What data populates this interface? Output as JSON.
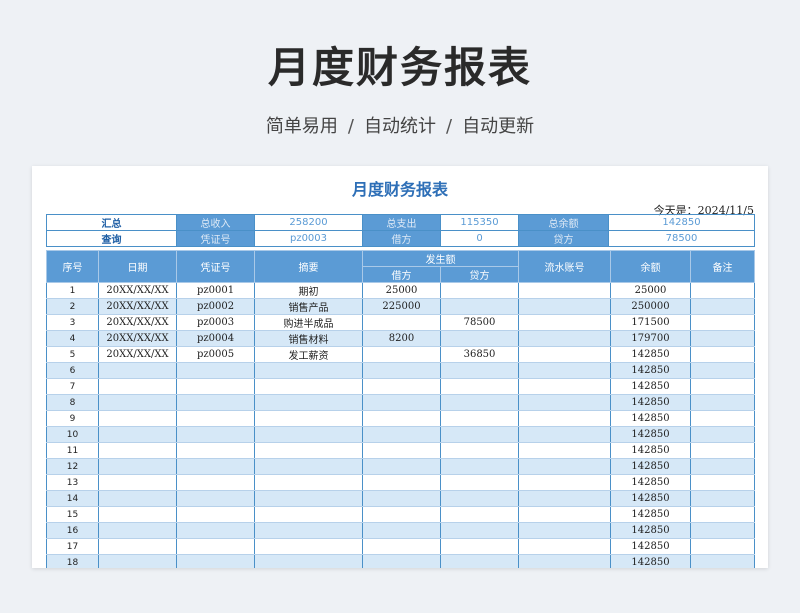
{
  "hero": {
    "title": "月度财务报表",
    "features": [
      "简单易用",
      "自动统计",
      "自动更新"
    ],
    "separator": "/"
  },
  "sheet": {
    "title": "月度财务报表",
    "today": "今天是：2024/11/5",
    "summary": {
      "row1": {
        "label": "汇总",
        "income_label": "总收入",
        "income": "258200",
        "expense_label": "总支出",
        "expense": "115350",
        "balance_label": "总余额",
        "balance": "142850"
      },
      "row2": {
        "label": "查询",
        "voucher_label": "凭证号",
        "voucher": "pz0003",
        "debit_label": "借方",
        "debit": "0",
        "credit_label": "贷方",
        "credit": "78500"
      }
    },
    "headers": {
      "seq": "序号",
      "date": "日期",
      "voucher": "凭证号",
      "summary": "摘要",
      "amount": "发生额",
      "debit": "借方",
      "credit": "贷方",
      "serial": "流水账号",
      "balance": "余额",
      "remark": "备注"
    },
    "rows": [
      {
        "seq": "1",
        "date": "20XX/XX/XX",
        "voucher": "pz0001",
        "summary": "期初",
        "debit": "25000",
        "credit": "",
        "serial": "",
        "balance": "25000",
        "remark": ""
      },
      {
        "seq": "2",
        "date": "20XX/XX/XX",
        "voucher": "pz0002",
        "summary": "销售产品",
        "debit": "225000",
        "credit": "",
        "serial": "",
        "balance": "250000",
        "remark": ""
      },
      {
        "seq": "3",
        "date": "20XX/XX/XX",
        "voucher": "pz0003",
        "summary": "购进半成品",
        "debit": "",
        "credit": "78500",
        "serial": "",
        "balance": "171500",
        "remark": ""
      },
      {
        "seq": "4",
        "date": "20XX/XX/XX",
        "voucher": "pz0004",
        "summary": "销售材料",
        "debit": "8200",
        "credit": "",
        "serial": "",
        "balance": "179700",
        "remark": ""
      },
      {
        "seq": "5",
        "date": "20XX/XX/XX",
        "voucher": "pz0005",
        "summary": "发工薪资",
        "debit": "",
        "credit": "36850",
        "serial": "",
        "balance": "142850",
        "remark": ""
      },
      {
        "seq": "6",
        "date": "",
        "voucher": "",
        "summary": "",
        "debit": "",
        "credit": "",
        "serial": "",
        "balance": "142850",
        "remark": ""
      },
      {
        "seq": "7",
        "date": "",
        "voucher": "",
        "summary": "",
        "debit": "",
        "credit": "",
        "serial": "",
        "balance": "142850",
        "remark": ""
      },
      {
        "seq": "8",
        "date": "",
        "voucher": "",
        "summary": "",
        "debit": "",
        "credit": "",
        "serial": "",
        "balance": "142850",
        "remark": ""
      },
      {
        "seq": "9",
        "date": "",
        "voucher": "",
        "summary": "",
        "debit": "",
        "credit": "",
        "serial": "",
        "balance": "142850",
        "remark": ""
      },
      {
        "seq": "10",
        "date": "",
        "voucher": "",
        "summary": "",
        "debit": "",
        "credit": "",
        "serial": "",
        "balance": "142850",
        "remark": ""
      },
      {
        "seq": "11",
        "date": "",
        "voucher": "",
        "summary": "",
        "debit": "",
        "credit": "",
        "serial": "",
        "balance": "142850",
        "remark": ""
      },
      {
        "seq": "12",
        "date": "",
        "voucher": "",
        "summary": "",
        "debit": "",
        "credit": "",
        "serial": "",
        "balance": "142850",
        "remark": ""
      },
      {
        "seq": "13",
        "date": "",
        "voucher": "",
        "summary": "",
        "debit": "",
        "credit": "",
        "serial": "",
        "balance": "142850",
        "remark": ""
      },
      {
        "seq": "14",
        "date": "",
        "voucher": "",
        "summary": "",
        "debit": "",
        "credit": "",
        "serial": "",
        "balance": "142850",
        "remark": ""
      },
      {
        "seq": "15",
        "date": "",
        "voucher": "",
        "summary": "",
        "debit": "",
        "credit": "",
        "serial": "",
        "balance": "142850",
        "remark": ""
      },
      {
        "seq": "16",
        "date": "",
        "voucher": "",
        "summary": "",
        "debit": "",
        "credit": "",
        "serial": "",
        "balance": "142850",
        "remark": ""
      },
      {
        "seq": "17",
        "date": "",
        "voucher": "",
        "summary": "",
        "debit": "",
        "credit": "",
        "serial": "",
        "balance": "142850",
        "remark": ""
      },
      {
        "seq": "18",
        "date": "",
        "voucher": "",
        "summary": "",
        "debit": "",
        "credit": "",
        "serial": "",
        "balance": "142850",
        "remark": ""
      }
    ]
  },
  "colors": {
    "header_blue": "#5b9bd5",
    "title_blue": "#2e6fb7",
    "row_alt": "#d6e8f7",
    "border": "#4a90c8"
  }
}
